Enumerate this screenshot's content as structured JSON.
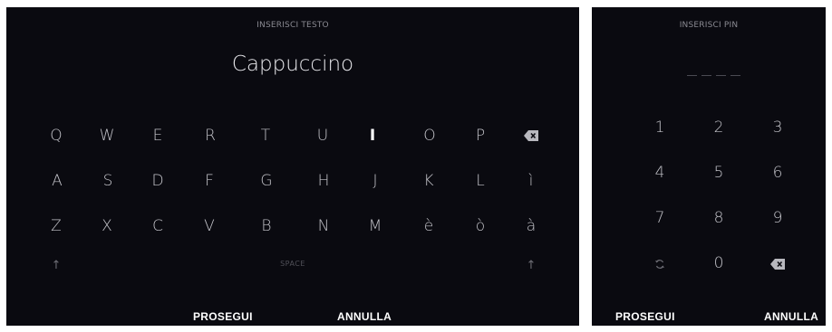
{
  "text_keyboard": {
    "title": "INSERISCI TESTO",
    "value": "Cappuccino",
    "rows": [
      [
        "Q",
        "W",
        "E",
        "R",
        "T",
        "U",
        "I",
        "O",
        "P"
      ],
      [
        "A",
        "S",
        "D",
        "F",
        "G",
        "H",
        "J",
        "K",
        "L",
        "ì"
      ],
      [
        "Z",
        "X",
        "C",
        "V",
        "B",
        "N",
        "M",
        "è",
        "ò",
        "à"
      ]
    ],
    "space_label": "SPACE",
    "continue_label": "PROSEGUI",
    "cancel_label": "ANNULLA",
    "backspace_icon": "backspace-icon",
    "shift_icon": "shift-arrow-icon"
  },
  "pin_keypad": {
    "title": "INSERISCI PIN",
    "digits": [
      "1",
      "2",
      "3",
      "4",
      "5",
      "6",
      "7",
      "8",
      "9",
      "0"
    ],
    "continue_label": "PROSEGUI",
    "cancel_label": "ANNULLA",
    "refresh_icon": "refresh-icon",
    "backspace_icon": "backspace-icon"
  },
  "colors": {
    "panel_bg": "#0a0a10",
    "key_text": "#c3c3c9",
    "action_text": "#ffffff"
  }
}
